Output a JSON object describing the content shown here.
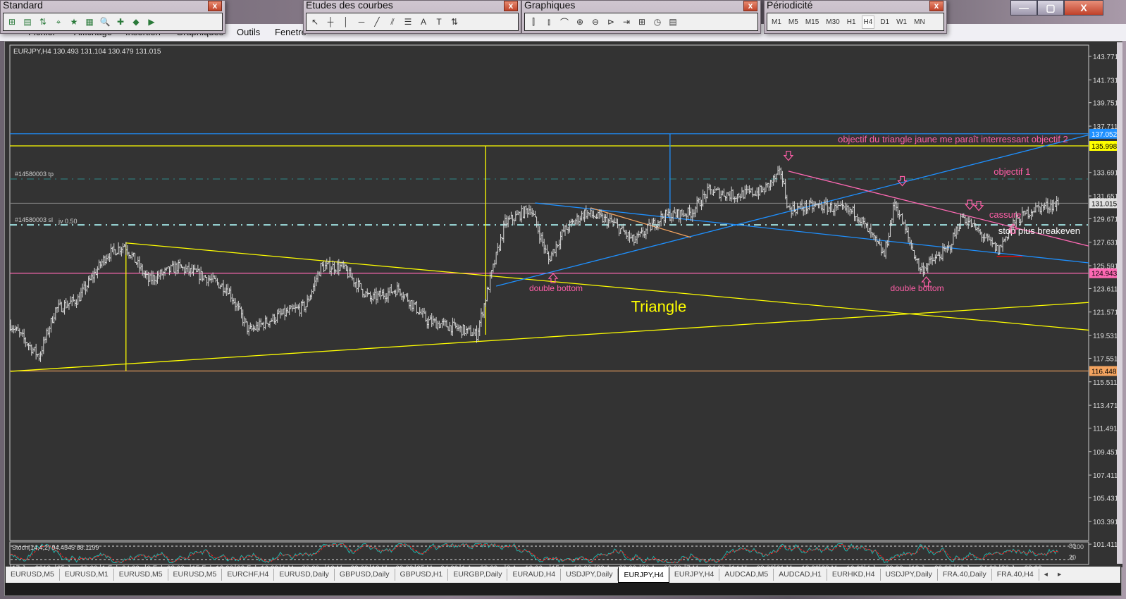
{
  "menu": [
    "Fichier",
    "Affichage",
    "Insertion",
    "Graphiques",
    "Outils",
    "Fenetre"
  ],
  "toolbars": {
    "standard": {
      "title": "Standard",
      "icons": [
        "new-chart-icon",
        "profiles-icon",
        "market-watch-icon",
        "navigator-icon",
        "data-window-icon",
        "terminal-icon",
        "strategy-tester-icon",
        "new-order-icon",
        "metaeditor-icon",
        "autotrading-icon"
      ]
    },
    "studies": {
      "title": "Etudes des courbes",
      "tools": [
        "↖",
        "┼",
        "│",
        "─",
        "╱",
        "⫽",
        "☰",
        "A",
        "T",
        "⇅"
      ]
    },
    "charts": {
      "title": "Graphiques",
      "tools": [
        "⫿",
        "⫾",
        "⌒",
        "⊕",
        "⊖",
        "⊳",
        "⇥",
        "⊞",
        "◷",
        "▤"
      ]
    },
    "period": {
      "title": "Périodicité",
      "items": [
        "M1",
        "M5",
        "M15",
        "M30",
        "H1",
        "H4",
        "D1",
        "W1",
        "MN"
      ],
      "selected": "H4"
    }
  },
  "window_buttons": {
    "minimize": "—",
    "restore": "▢",
    "close": "X"
  },
  "mdi_buttons": {
    "minimize": "-",
    "restore": "🗗",
    "close": "x"
  },
  "chart": {
    "header": "EURJPY,H4  130.493 131.104 130.479 131.015",
    "tp_label": "#14580003 tp",
    "sl_label": "#14580003 sl",
    "sl_volume": "jv 0.50",
    "stoch_label": "Stoch(14,4,2) 94.4545 88.1199",
    "stoch_levels": [
      "80",
      "100",
      "20",
      "0"
    ]
  },
  "chart_data": {
    "type": "bar",
    "symbol": "EURJPY",
    "timeframe": "H4",
    "ylim": [
      101.411,
      143.771
    ],
    "price_ticks": [
      "143.771",
      "141.731",
      "139.751",
      "137.711",
      "133.691",
      "131.651",
      "129.671",
      "127.631",
      "125.591",
      "123.611",
      "121.571",
      "119.531",
      "117.551",
      "115.511",
      "113.471",
      "111.491",
      "109.451",
      "107.411",
      "105.431",
      "103.391",
      "101.411"
    ],
    "date_labels": [
      "17 Jan 2013",
      "25 Jan 00:00",
      "1 Feb 04:00",
      "8 Feb 08:00",
      "15 Feb 12:00",
      "22 Feb 16:00",
      "1 Mar 20:00",
      "10 Mar 23:00",
      "18 Mar 00:00",
      "25 Mar 04:00",
      "1 Apr 08:00",
      "8 Apr 12:00",
      "15 Apr 16:00",
      "22 Apr 20:00",
      "30 Apr 00:00",
      "7 May 04:00",
      "14 May 08:00",
      "21 May 12:00",
      "28 May 16:00",
      "4 Jun 20:00",
      "12 Jun 00:00",
      "19 Jun 04:00",
      "26 Jun 08:00"
    ],
    "bars_per_label": 30,
    "price_path": [
      [
        0,
        120.5
      ],
      [
        19,
        117.7
      ],
      [
        30,
        121.8
      ],
      [
        45,
        122.7
      ],
      [
        64,
        126.5
      ],
      [
        76,
        127.4
      ],
      [
        92,
        124.3
      ],
      [
        111,
        125.5
      ],
      [
        130,
        124.6
      ],
      [
        145,
        123.6
      ],
      [
        159,
        119.9
      ],
      [
        178,
        121.2
      ],
      [
        197,
        122.1
      ],
      [
        207,
        125.5
      ],
      [
        221,
        125.5
      ],
      [
        240,
        122.7
      ],
      [
        259,
        123.6
      ],
      [
        278,
        120.8
      ],
      [
        297,
        120.2
      ],
      [
        311,
        119.6
      ],
      [
        321,
        124.9
      ],
      [
        330,
        129.3
      ],
      [
        347,
        130.6
      ],
      [
        359,
        126.1
      ],
      [
        369,
        128.6
      ],
      [
        383,
        130.2
      ],
      [
        402,
        129.3
      ],
      [
        416,
        127.7
      ],
      [
        435,
        129.9
      ],
      [
        454,
        130.2
      ],
      [
        466,
        132.1
      ],
      [
        483,
        131.7
      ],
      [
        502,
        132.1
      ],
      [
        514,
        133.7
      ],
      [
        519,
        130.5
      ],
      [
        540,
        130.8
      ],
      [
        564,
        130.2
      ],
      [
        583,
        126.5
      ],
      [
        590,
        131.1
      ],
      [
        607,
        125.2
      ],
      [
        616,
        126.1
      ],
      [
        626,
        127.1
      ],
      [
        635,
        129.9
      ],
      [
        650,
        128.0
      ],
      [
        659,
        126.9
      ],
      [
        669,
        129.3
      ],
      [
        682,
        130.5
      ],
      [
        699,
        131.0
      ]
    ],
    "hlines": [
      {
        "price": 137.052,
        "color": "#1e90ff",
        "label": "137.052",
        "label_bg": "#1e90ff",
        "label_fg": "#ffffff"
      },
      {
        "price": 135.998,
        "color": "#ffff00",
        "label": "135.998",
        "label_bg": "#ffff00",
        "label_fg": "#000000"
      },
      {
        "price": 131.015,
        "color": "#808080",
        "label": "131.015",
        "label_bg": "#e0e0e0",
        "label_fg": "#000000"
      },
      {
        "price": 124.943,
        "color": "#ff69b4",
        "label": "124.943",
        "label_bg": "#ff69b4",
        "label_fg": "#000000"
      },
      {
        "price": 116.448,
        "color": "#f4a460",
        "label": "116.448",
        "label_bg": "#f4a460",
        "label_fg": "#000000"
      }
    ],
    "tp_price": 133.12,
    "sl_price": 129.14,
    "trendlines": [
      {
        "name": "triangle-upper",
        "color": "#ffff00",
        "from": [
          77,
          127.57
        ],
        "to": [
          720,
          120.0
        ]
      },
      {
        "name": "triangle-lower",
        "color": "#ffff00",
        "from": [
          0,
          116.42
        ],
        "to": [
          720,
          122.4
        ]
      },
      {
        "name": "triangle-height-1",
        "color": "#ffff00",
        "from": [
          77,
          116.45
        ],
        "to": [
          77,
          127.57
        ]
      },
      {
        "name": "triangle-height-2",
        "color": "#ffff00",
        "from": [
          317,
          119.6
        ],
        "to": [
          317,
          135.998
        ]
      },
      {
        "name": "blue-vertical",
        "color": "#1e90ff",
        "from": [
          440,
          129.82
        ],
        "to": [
          440,
          137.052
        ]
      },
      {
        "name": "blue-rising",
        "color": "#1e90ff",
        "from": [
          324,
          123.82
        ],
        "to": [
          720,
          136.95
        ]
      },
      {
        "name": "blue-falling",
        "color": "#1e90ff",
        "from": [
          350,
          131.04
        ],
        "to": [
          720,
          125.84
        ]
      },
      {
        "name": "orange-line",
        "color": "#f4a460",
        "from": [
          387,
          130.62
        ],
        "to": [
          454,
          128.05
        ]
      },
      {
        "name": "pink-falling",
        "color": "#ff69b4",
        "from": [
          519,
          133.8
        ],
        "to": [
          720,
          127.3
        ]
      },
      {
        "name": "red-stop",
        "color": "#ff0000",
        "from": [
          658,
          126.4
        ],
        "to": [
          675,
          126.4
        ]
      }
    ],
    "annotations": [
      {
        "text": "objectif du triangle jaune me paraît interressant objectif 2",
        "at": [
          552,
          136.3
        ],
        "color": "#ff5fa8",
        "size": 13
      },
      {
        "text": "objectif 1",
        "at": [
          656,
          133.5
        ],
        "color": "#ff5fa8",
        "size": 13
      },
      {
        "text": "cassure",
        "at": [
          653,
          129.75
        ],
        "color": "#ff5fa8",
        "size": 13
      },
      {
        "text": "stop plus breakeven",
        "at": [
          659,
          128.35
        ],
        "color": "#ffffff",
        "size": 13
      },
      {
        "text": "double bottom",
        "at": [
          346,
          123.4
        ],
        "color": "#ff5fa8",
        "size": 12
      },
      {
        "text": "double bottom",
        "at": [
          587,
          123.4
        ],
        "color": "#ff5fa8",
        "size": 12
      },
      {
        "text": "Triangle",
        "at": [
          414,
          121.6
        ],
        "color": "#ffff00",
        "size": 22
      }
    ],
    "arrows": [
      {
        "dir": "down",
        "at": [
          519,
          134.8
        ]
      },
      {
        "dir": "down",
        "at": [
          595,
          132.6
        ]
      },
      {
        "dir": "down",
        "at": [
          640,
          130.55
        ]
      },
      {
        "dir": "down",
        "at": [
          646,
          130.45
        ]
      },
      {
        "dir": "up",
        "at": [
          362,
          124.85
        ]
      },
      {
        "dir": "up",
        "at": [
          611,
          124.55
        ]
      },
      {
        "dir": "up",
        "at": [
          669,
          129.14
        ]
      }
    ]
  },
  "tabs": [
    "EURUSD,M5",
    "EURUSD,M1",
    "EURUSD,M5",
    "EURUSD,M5",
    "EURCHF,H4",
    "EURUSD,Daily",
    "GBPUSD,Daily",
    "GBPUSD,H1",
    "EURGBP,Daily",
    "EURAUD,H4",
    "USDJPY,Daily",
    "EURJPY,H4",
    "EURJPY,H4",
    "AUDCAD,M5",
    "AUDCAD,H1",
    "EURHKD,H4",
    "USDJPY,Daily",
    "FRA.40,Daily",
    "FRA.40,H4"
  ],
  "active_tab": 11,
  "tab_scroll": {
    "left": "◂",
    "right": "▸"
  }
}
